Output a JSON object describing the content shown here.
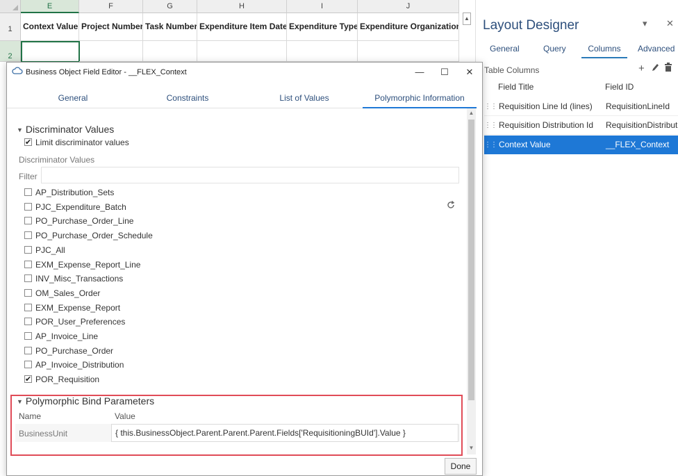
{
  "sheet": {
    "columns": [
      "E",
      "F",
      "G",
      "H",
      "I",
      "J"
    ],
    "row_numbers": [
      "1",
      "2"
    ],
    "headers": [
      "Context Value",
      "Project Number",
      "Task Number",
      "Expenditure Item Date",
      "Expenditure Type",
      "Expenditure Organization"
    ]
  },
  "layout_designer": {
    "title": "Layout Designer",
    "pin_glyph": "▾",
    "close_glyph": "✕",
    "tabs": [
      "General",
      "Query",
      "Columns",
      "Advanced"
    ],
    "active_tab": "Columns",
    "section_label": "Table Columns",
    "action_icons": [
      "plus-icon",
      "pencil-icon",
      "trash-icon"
    ],
    "column_headers": {
      "field_title": "Field Title",
      "field_id": "Field ID"
    },
    "rows": [
      {
        "title": "Requisition Line Id (lines)",
        "id": "RequisitionLineId"
      },
      {
        "title": "Requisition Distribution Id",
        "id": "RequisitionDistribut"
      },
      {
        "title": "Context Value",
        "id": "__FLEX_Context"
      }
    ],
    "selected_row": "Context Value",
    "accent_color": "#1e78d6"
  },
  "dialog": {
    "title": "Business Object Field Editor - __FLEX_Context",
    "minimize": "—",
    "maximize": "☐",
    "close": "✕",
    "tabs": [
      "General",
      "Constraints",
      "List of Values",
      "Polymorphic Information"
    ],
    "active_tab": "Polymorphic Information",
    "discriminator": {
      "heading": "Discriminator Values",
      "limit_label": "Limit discriminator values",
      "limit_checked": true,
      "values_label": "Discriminator Values",
      "filter_label": "Filter",
      "filter_value": "",
      "items": [
        {
          "label": "AP_Distribution_Sets",
          "checked": false
        },
        {
          "label": "PJC_Expenditure_Batch",
          "checked": false
        },
        {
          "label": "PO_Purchase_Order_Line",
          "checked": false
        },
        {
          "label": "PO_Purchase_Order_Schedule",
          "checked": false
        },
        {
          "label": "PJC_All",
          "checked": false
        },
        {
          "label": "EXM_Expense_Report_Line",
          "checked": false
        },
        {
          "label": "INV_Misc_Transactions",
          "checked": false
        },
        {
          "label": "OM_Sales_Order",
          "checked": false
        },
        {
          "label": "EXM_Expense_Report",
          "checked": false
        },
        {
          "label": "POR_User_Preferences",
          "checked": false
        },
        {
          "label": "AP_Invoice_Line",
          "checked": false
        },
        {
          "label": "PO_Purchase_Order",
          "checked": false
        },
        {
          "label": "AP_Invoice_Distribution",
          "checked": false
        },
        {
          "label": "POR_Requisition",
          "checked": true
        }
      ]
    },
    "bind_params": {
      "heading": "Polymorphic Bind Parameters",
      "name_header": "Name",
      "value_header": "Value",
      "rows": [
        {
          "name": "BusinessUnit",
          "value": "{ this.BusinessObject.Parent.Parent.Parent.Fields['RequisitioningBUId'].Value }"
        }
      ]
    },
    "done_label": "Done",
    "highlight_color": "#e04b57"
  }
}
